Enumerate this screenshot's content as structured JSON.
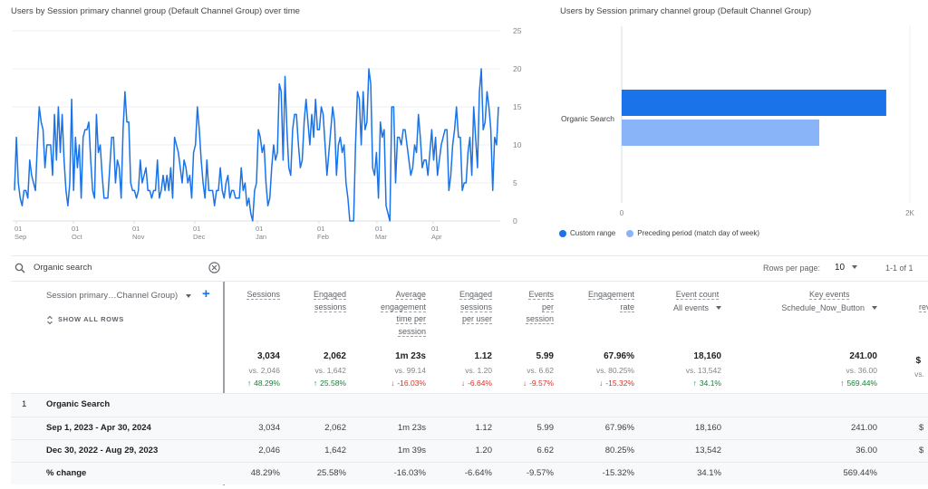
{
  "line_chart": {
    "title": "Users by Session primary channel group (Default Channel Group) over time",
    "color": "#1a73e8"
  },
  "bar_chart": {
    "title": "Users by Session primary channel group (Default Channel Group)",
    "custom_color": "#1a73e8",
    "preceding_color": "#8ab4f8"
  },
  "chart_data": [
    {
      "type": "line",
      "title": "Users by Session primary channel group (Default Channel Group) over time",
      "xlabel": "",
      "ylabel": "",
      "ylim": [
        0,
        25
      ],
      "yticks": [
        "25",
        "20",
        "15",
        "10",
        "5",
        "0"
      ],
      "xticks": [
        {
          "day": "01",
          "month": "Sep"
        },
        {
          "day": "01",
          "month": "Oct"
        },
        {
          "day": "01",
          "month": "Nov"
        },
        {
          "day": "01",
          "month": "Dec"
        },
        {
          "day": "01",
          "month": "Jan"
        },
        {
          "day": "01",
          "month": "Feb"
        },
        {
          "day": "01",
          "month": "Mar"
        },
        {
          "day": "01",
          "month": "Apr"
        }
      ],
      "grid": true,
      "series": [
        {
          "name": "Organic Search",
          "values": [
            4,
            11,
            5,
            3,
            2,
            4,
            4,
            3,
            8,
            6,
            5,
            4,
            10,
            15,
            13,
            12,
            7,
            10,
            10,
            10,
            6,
            14,
            8,
            15,
            9,
            14,
            8,
            4,
            2,
            5,
            16,
            4,
            11,
            7,
            10,
            3,
            11,
            12,
            12,
            13,
            8,
            4,
            3,
            14,
            9,
            10,
            6,
            3,
            3,
            3,
            7,
            11,
            11,
            5,
            8,
            7,
            3,
            12,
            17,
            13,
            13,
            5,
            4,
            4,
            3,
            4,
            8,
            5,
            6,
            7,
            4,
            4,
            3,
            4,
            4,
            8,
            3,
            4,
            6,
            4,
            6,
            4,
            7,
            3,
            11,
            10,
            9,
            7,
            5,
            8,
            7,
            5,
            6,
            3,
            9,
            10,
            15,
            12,
            8,
            5,
            3,
            8,
            4,
            4,
            4,
            2,
            4,
            4,
            7,
            4,
            3,
            5,
            6,
            3,
            4,
            4,
            3,
            3,
            3,
            7,
            4,
            5,
            2,
            3,
            1,
            0,
            4,
            5,
            12,
            11,
            9,
            10,
            5,
            2,
            3,
            7,
            10,
            8,
            9,
            18,
            17,
            8,
            19,
            12,
            7,
            6,
            12,
            14,
            14,
            10,
            7,
            8,
            13,
            16,
            13,
            10,
            14,
            11,
            16,
            12,
            12,
            15,
            14,
            10,
            6,
            9,
            12,
            15,
            13,
            6,
            10,
            11,
            9,
            10,
            5,
            3,
            0,
            0,
            0,
            10,
            17,
            16,
            10,
            17,
            12,
            13,
            20,
            18,
            7,
            6,
            9,
            3,
            13,
            11,
            12,
            2,
            1,
            0,
            15,
            15,
            5,
            11,
            11,
            10,
            12,
            12,
            10,
            8,
            6,
            7,
            10,
            9,
            14,
            11,
            7,
            8,
            8,
            6,
            9,
            12,
            8,
            11,
            6,
            8,
            10,
            11,
            12,
            12,
            4,
            6,
            10,
            12,
            15,
            11,
            11,
            4,
            5,
            5,
            9,
            11,
            6,
            15,
            11,
            7,
            17,
            20,
            12,
            13,
            17,
            15,
            12,
            4,
            11,
            10,
            15
          ]
        }
      ]
    },
    {
      "type": "bar",
      "orientation": "horizontal",
      "title": "Users by Session primary channel group (Default Channel Group)",
      "categories": [
        "Organic Search"
      ],
      "series": [
        {
          "name": "Custom range",
          "values": [
            1836
          ]
        },
        {
          "name": "Preceding period (match day of week)",
          "values": [
            1371
          ]
        }
      ],
      "xlim": [
        0,
        2000
      ],
      "xticks": [
        "0",
        "2K"
      ],
      "legend": "bottom-left"
    }
  ],
  "toolbar": {
    "search_value": "Organic search",
    "rows_per_page_label": "Rows per page:",
    "rows_per_page_value": "10",
    "pagination": "1-1 of 1"
  },
  "table": {
    "dimension_header": "Session primary…Channel Group)",
    "show_all_rows": "SHOW ALL ROWS",
    "columns": [
      {
        "lines": [
          "Sessions"
        ]
      },
      {
        "lines": [
          "Engaged",
          "sessions"
        ]
      },
      {
        "lines": [
          "Average",
          "engagement",
          "time per",
          "session"
        ]
      },
      {
        "lines": [
          "Engaged",
          "sessions",
          "per user"
        ]
      },
      {
        "lines": [
          "Events",
          "per",
          "session"
        ]
      },
      {
        "lines": [
          "Engagement",
          "rate"
        ]
      },
      {
        "lines": [
          "Event count"
        ],
        "selector": "All events"
      },
      {
        "lines": [
          "Key events"
        ],
        "selector": "Schedule_Now_Button"
      },
      {
        "lines": [
          "rev"
        ]
      }
    ],
    "totals": [
      {
        "main": "3,034",
        "vs": "vs. 2,046",
        "change": "48.29%",
        "dir": "up"
      },
      {
        "main": "2,062",
        "vs": "vs. 1,642",
        "change": "25.58%",
        "dir": "up"
      },
      {
        "main": "1m 23s",
        "vs": "vs. 99.14",
        "change": "-16.03%",
        "dir": "down"
      },
      {
        "main": "1.12",
        "vs": "vs. 1.20",
        "change": "-6.64%",
        "dir": "down"
      },
      {
        "main": "5.99",
        "vs": "vs. 6.62",
        "change": "-9.57%",
        "dir": "down"
      },
      {
        "main": "67.96%",
        "vs": "vs. 80.25%",
        "change": "-15.32%",
        "dir": "down"
      },
      {
        "main": "18,160",
        "vs": "vs. 13,542",
        "change": "34.1%",
        "dir": "up"
      },
      {
        "main": "241.00",
        "vs": "vs. 36.00",
        "change": "569.44%",
        "dir": "up"
      },
      {
        "main": "$",
        "vs": "vs.",
        "change": "",
        "dir": ""
      }
    ],
    "group_row": {
      "index": "1",
      "label": "Organic Search"
    },
    "rows": [
      {
        "label": "Sep 1, 2023 - Apr 30, 2024",
        "values": [
          "3,034",
          "2,062",
          "1m 23s",
          "1.12",
          "5.99",
          "67.96%",
          "18,160",
          "241.00",
          "$"
        ]
      },
      {
        "label": "Dec 30, 2022 - Aug 29, 2023",
        "values": [
          "2,046",
          "1,642",
          "1m 39s",
          "1.20",
          "6.62",
          "80.25%",
          "13,542",
          "36.00",
          "$"
        ]
      },
      {
        "label": "% change",
        "values": [
          "48.29%",
          "25.58%",
          "-16.03%",
          "-6.64%",
          "-9.57%",
          "-15.32%",
          "34.1%",
          "569.44%",
          ""
        ]
      }
    ],
    "arrow_up": "↑",
    "arrow_down": "↓"
  }
}
